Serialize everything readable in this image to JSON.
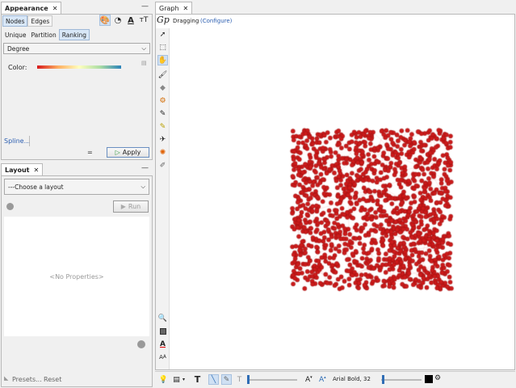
{
  "appearance": {
    "title": "Appearance",
    "tabs": [
      "Nodes",
      "Edges"
    ],
    "subtabs": [
      "Unique",
      "Partition",
      "Ranking"
    ],
    "attribute": "Degree",
    "color_label": "Color:",
    "spline_label": "Spline...",
    "apply_label": "Apply"
  },
  "layout": {
    "title": "Layout",
    "choose": "---Choose a layout",
    "run_label": "Run",
    "no_properties": "<No Properties>",
    "presets_label": "Presets...",
    "reset_label": "Reset"
  },
  "graph": {
    "tab_title": "Graph",
    "mode_label": "Dragging",
    "configure_label": "(Configure)",
    "font_label": "Arial Bold, 32",
    "node_color": "#cc1a1a",
    "edge_color": "#f3b3b3"
  },
  "icons": {
    "close": "close-icon",
    "minimize": "minimize-icon"
  }
}
